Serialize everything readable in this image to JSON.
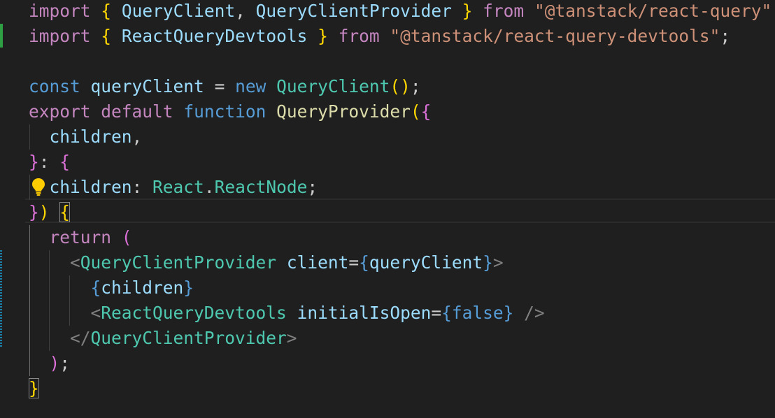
{
  "editor": {
    "lines": [
      {
        "tokens": [
          {
            "t": "import",
            "c": "kw-purple"
          },
          {
            "t": " ",
            "c": "punct"
          },
          {
            "t": "{",
            "c": "br1"
          },
          {
            "t": " ",
            "c": "punct"
          },
          {
            "t": "QueryClient",
            "c": "var"
          },
          {
            "t": ", ",
            "c": "punct"
          },
          {
            "t": "QueryClientProvider",
            "c": "var"
          },
          {
            "t": " ",
            "c": "punct"
          },
          {
            "t": "}",
            "c": "br1"
          },
          {
            "t": " ",
            "c": "punct"
          },
          {
            "t": "from",
            "c": "kw-purple"
          },
          {
            "t": " ",
            "c": "punct"
          },
          {
            "t": "\"@tanstack/react-query\"",
            "c": "str"
          },
          {
            "t": ";",
            "c": "punct"
          }
        ]
      },
      {
        "tokens": [
          {
            "t": "import",
            "c": "kw-purple"
          },
          {
            "t": " ",
            "c": "punct"
          },
          {
            "t": "{",
            "c": "br1"
          },
          {
            "t": " ",
            "c": "punct"
          },
          {
            "t": "ReactQueryDevtools",
            "c": "var"
          },
          {
            "t": " ",
            "c": "punct"
          },
          {
            "t": "}",
            "c": "br1"
          },
          {
            "t": " ",
            "c": "punct"
          },
          {
            "t": "from",
            "c": "kw-purple"
          },
          {
            "t": " ",
            "c": "punct"
          },
          {
            "t": "\"@tanstack/react-query-devtools\"",
            "c": "str"
          },
          {
            "t": ";",
            "c": "punct"
          }
        ]
      },
      {
        "tokens": []
      },
      {
        "tokens": [
          {
            "t": "const",
            "c": "kw-blue"
          },
          {
            "t": " ",
            "c": "punct"
          },
          {
            "t": "queryClient",
            "c": "var"
          },
          {
            "t": " ",
            "c": "punct"
          },
          {
            "t": "=",
            "c": "punct"
          },
          {
            "t": " ",
            "c": "punct"
          },
          {
            "t": "new",
            "c": "kw-blue"
          },
          {
            "t": " ",
            "c": "punct"
          },
          {
            "t": "QueryClient",
            "c": "type"
          },
          {
            "t": "()",
            "c": "br1"
          },
          {
            "t": ";",
            "c": "punct"
          }
        ]
      },
      {
        "tokens": [
          {
            "t": "export",
            "c": "kw-purple"
          },
          {
            "t": " ",
            "c": "punct"
          },
          {
            "t": "default",
            "c": "kw-purple"
          },
          {
            "t": " ",
            "c": "punct"
          },
          {
            "t": "function",
            "c": "kw-blue"
          },
          {
            "t": " ",
            "c": "punct"
          },
          {
            "t": "QueryProvider",
            "c": "fn"
          },
          {
            "t": "(",
            "c": "br1"
          },
          {
            "t": "{",
            "c": "br2"
          }
        ]
      },
      {
        "tokens": [
          {
            "t": "  ",
            "c": "punct"
          },
          {
            "t": "children",
            "c": "var"
          },
          {
            "t": ",",
            "c": "punct"
          }
        ]
      },
      {
        "tokens": [
          {
            "t": "}",
            "c": "br2"
          },
          {
            "t": ": ",
            "c": "punct"
          },
          {
            "t": "{",
            "c": "br2"
          }
        ]
      },
      {
        "tokens": [
          {
            "t": "  ",
            "c": "punct"
          },
          {
            "t": "children",
            "c": "var"
          },
          {
            "t": ": ",
            "c": "punct"
          },
          {
            "t": "React",
            "c": "type"
          },
          {
            "t": ".",
            "c": "punct"
          },
          {
            "t": "ReactNode",
            "c": "type"
          },
          {
            "t": ";",
            "c": "punct"
          }
        ]
      },
      {
        "tokens": [
          {
            "t": "}",
            "c": "br2"
          },
          {
            "t": ")",
            "c": "br1"
          },
          {
            "t": " ",
            "c": "punct"
          },
          {
            "t": "{",
            "c": "br1",
            "box": true
          }
        ]
      },
      {
        "tokens": [
          {
            "t": "  ",
            "c": "punct"
          },
          {
            "t": "return",
            "c": "kw-purple"
          },
          {
            "t": " ",
            "c": "punct"
          },
          {
            "t": "(",
            "c": "br2"
          }
        ]
      },
      {
        "tokens": [
          {
            "t": "    ",
            "c": "punct"
          },
          {
            "t": "<",
            "c": "tagbr"
          },
          {
            "t": "QueryClientProvider",
            "c": "type"
          },
          {
            "t": " ",
            "c": "punct"
          },
          {
            "t": "client",
            "c": "var"
          },
          {
            "t": "=",
            "c": "punct"
          },
          {
            "t": "{",
            "c": "kw-blue"
          },
          {
            "t": "queryClient",
            "c": "var"
          },
          {
            "t": "}",
            "c": "kw-blue"
          },
          {
            "t": ">",
            "c": "tagbr"
          }
        ]
      },
      {
        "tokens": [
          {
            "t": "      ",
            "c": "punct"
          },
          {
            "t": "{",
            "c": "kw-blue"
          },
          {
            "t": "children",
            "c": "var"
          },
          {
            "t": "}",
            "c": "kw-blue"
          }
        ]
      },
      {
        "tokens": [
          {
            "t": "      ",
            "c": "punct"
          },
          {
            "t": "<",
            "c": "tagbr"
          },
          {
            "t": "ReactQueryDevtools",
            "c": "type"
          },
          {
            "t": " ",
            "c": "punct"
          },
          {
            "t": "initialIsOpen",
            "c": "var"
          },
          {
            "t": "=",
            "c": "punct"
          },
          {
            "t": "{",
            "c": "kw-blue"
          },
          {
            "t": "false",
            "c": "kw-blue"
          },
          {
            "t": "}",
            "c": "kw-blue"
          },
          {
            "t": " ",
            "c": "punct"
          },
          {
            "t": "/>",
            "c": "tagbr"
          }
        ]
      },
      {
        "tokens": [
          {
            "t": "    ",
            "c": "punct"
          },
          {
            "t": "</",
            "c": "tagbr"
          },
          {
            "t": "QueryClientProvider",
            "c": "type"
          },
          {
            "t": ">",
            "c": "tagbr"
          }
        ]
      },
      {
        "tokens": [
          {
            "t": "  ",
            "c": "punct"
          },
          {
            "t": ")",
            "c": "br2"
          },
          {
            "t": ";",
            "c": "punct"
          }
        ]
      },
      {
        "tokens": [
          {
            "t": "}",
            "c": "br1",
            "box": true
          }
        ]
      }
    ]
  },
  "colors": {
    "background": "#1f1f1f",
    "git_added": "#2ea043",
    "git_modified": "#1b81a8",
    "lightbulb": "#ffcc00"
  },
  "icons": {
    "lightbulb": "lightbulb-icon"
  }
}
